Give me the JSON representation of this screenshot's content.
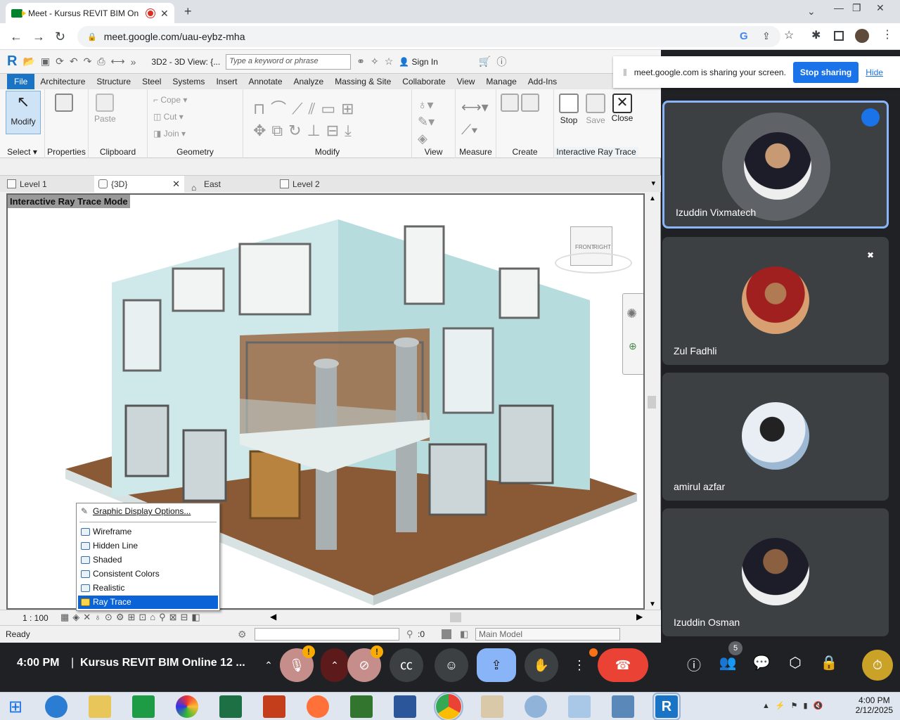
{
  "browser": {
    "tab_title": "Meet - Kursus REVIT BIM On",
    "url": "meet.google.com/uau-eybz-mha"
  },
  "revit": {
    "view_title": "3D2 - 3D View: {...",
    "search_placeholder": "Type a keyword or phrase",
    "sign_in": "Sign In",
    "ribbon_tabs": [
      "File",
      "Architecture",
      "Structure",
      "Steel",
      "Systems",
      "Insert",
      "Annotate",
      "Analyze",
      "Massing & Site",
      "Collaborate",
      "View",
      "Manage",
      "Add-Ins"
    ],
    "modify_label": "Modify",
    "groups": {
      "select": "Select",
      "properties": "Properties",
      "clipboard": "Clipboard",
      "geometry": "Geometry",
      "modify": "Modify",
      "view": "View",
      "measure": "Measure",
      "create": "Create",
      "interactive_ray_trace": "Interactive Ray Trace"
    },
    "tools": {
      "paste": "Paste",
      "cope": "Cope",
      "cut": "Cut",
      "join": "Join",
      "stop": "Stop",
      "save": "Save",
      "close": "Close"
    },
    "view_tabs": [
      "Level 1",
      "{3D}",
      "East",
      "Level 2"
    ],
    "viewport_label": "Interactive Ray Trace Mode",
    "viewcube_front": "FRONT",
    "viewcube_right": "RIGHT",
    "scale": "1 : 100",
    "status": "Ready",
    "selection_count": ":0",
    "model": "Main Model",
    "context_menu": {
      "header": "Graphic Display Options...",
      "items": [
        "Wireframe",
        "Hidden Line",
        "Shaded",
        "Consistent Colors",
        "Realistic",
        "Ray Trace"
      ],
      "selected": "Ray Trace"
    }
  },
  "sharing": {
    "text": "meet.google.com is sharing your screen.",
    "stop_button": "Stop sharing",
    "hide_link": "Hide"
  },
  "participants": [
    {
      "name": "Izuddin Vixmatech",
      "speaking": true,
      "muted": false
    },
    {
      "name": "Zul Fadhli",
      "speaking": false,
      "muted": true
    },
    {
      "name": "amirul azfar",
      "speaking": false,
      "muted": false
    },
    {
      "name": "Izuddin Osman",
      "speaking": false,
      "muted": false
    }
  ],
  "meet_bar": {
    "time": "4:00 PM",
    "meeting_title": "Kursus REVIT BIM Online 12 ...",
    "people_count": "5"
  },
  "taskbar": {
    "time": "4:00 PM",
    "date": "2/12/2025"
  },
  "colors": {
    "revit_file_tab": "#1a74c6",
    "meet_blue": "#1a73e8",
    "hangup_red": "#ea4335",
    "menu_selected": "#0a64d8"
  }
}
